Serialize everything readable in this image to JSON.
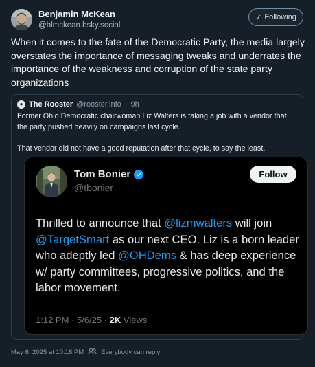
{
  "author": {
    "name": "Benjamin McKean",
    "handle": "@blmckean.bsky.social",
    "following_label": "Following"
  },
  "post": {
    "text": "When it comes to the fate of the Democratic Party, the media largely overstates the importance of messaging tweaks and underrates the importance of the weakness and corruption of the state party organizations"
  },
  "quote": {
    "author_name": "The Rooster",
    "author_handle": "@rooster.info",
    "time": "9h",
    "paragraph1": "Former Ohio Democratic chairwoman Liz Walters is taking a job with a vendor that the party pushed heavily on campaigns last cycle.",
    "paragraph2": "That vendor did not have a good reputation after that cycle, to say the least."
  },
  "embed": {
    "name": "Tom Bonier",
    "handle": "@tbonier",
    "follow_label": "Follow",
    "text_1": "Thrilled to announce that ",
    "mention_1": "@lizmwalters",
    "text_2": " will join ",
    "mention_2": "@TargetSmart",
    "text_3": " as our next CEO. Liz is a born leader who adeptly led ",
    "mention_3": "@OHDems",
    "text_4": " & has deep experience w/ party committees, progressive politics, and the labor movement.",
    "time": "1:12 PM · 5/6/25 · ",
    "views_count": "2K",
    "views_label": " Views"
  },
  "footer": {
    "timestamp": "May 6, 2025 at 10:18 PM",
    "reply_setting": "Everybody can reply"
  },
  "colors": {
    "background": "#161e27",
    "mention": "#1d9bf0",
    "verified": "#1d9bf0"
  }
}
